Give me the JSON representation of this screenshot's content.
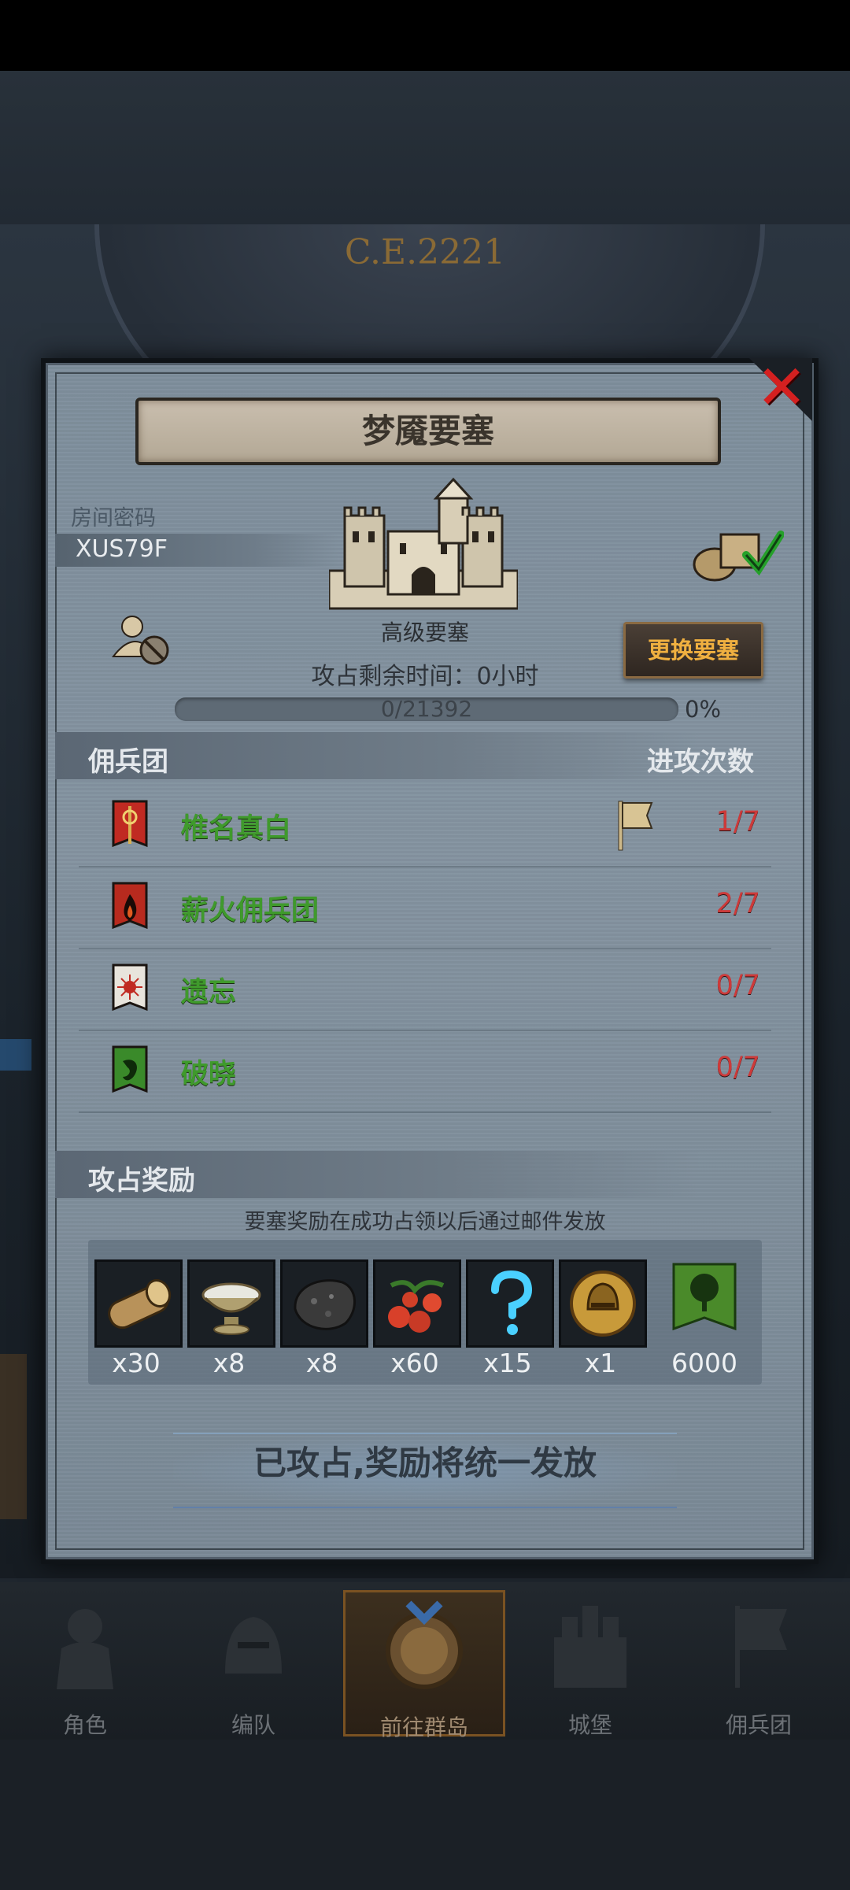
{
  "background": {
    "era_text": "C.E.2221"
  },
  "modal": {
    "title": "梦魇要塞",
    "room_label": "房间密码",
    "room_code": "XUS79F",
    "fortress_level": "高级要塞",
    "change_button": "更换要塞",
    "time_left": "攻占剩余时间：0小时",
    "progress": {
      "text": "0/21392",
      "current": 0,
      "total": 21392,
      "percent_label": "0%"
    }
  },
  "mercenaries": {
    "section_title": "佣兵团",
    "attack_count_label": "进攻次数",
    "rows": [
      {
        "name": "椎名真白",
        "count": "1/7",
        "banner_color": "#c02a22",
        "banner_icon": "staff-icon",
        "flag": true
      },
      {
        "name": "薪火佣兵团",
        "count": "2/7",
        "banner_color": "#b82a1e",
        "banner_icon": "flame-icon",
        "flag": false
      },
      {
        "name": "遗忘",
        "count": "0/7",
        "banner_color": "#e8e4dc",
        "banner_icon": "sun-icon",
        "flag": false
      },
      {
        "name": "破晓",
        "count": "0/7",
        "banner_color": "#3a8a2a",
        "banner_icon": "dragon-icon",
        "flag": false
      }
    ]
  },
  "rewards": {
    "section_title": "攻占奖励",
    "note": "要塞奖励在成功占领以后通过邮件发放",
    "items": [
      {
        "icon": "wood-log-icon",
        "qty": "x30"
      },
      {
        "icon": "bowl-icon",
        "qty": "x8"
      },
      {
        "icon": "ore-icon",
        "qty": "x8"
      },
      {
        "icon": "berries-icon",
        "qty": "x60"
      },
      {
        "icon": "mystery-icon",
        "qty": "x15"
      },
      {
        "icon": "helmet-medal-icon",
        "qty": "x1"
      },
      {
        "icon": "tree-banner-icon",
        "qty": "6000"
      }
    ],
    "claim_text": "已攻占,奖励将统一发放"
  },
  "nav": {
    "items": [
      {
        "label": "角色",
        "icon": "knight-icon",
        "active": false
      },
      {
        "label": "编队",
        "icon": "helmet-icon",
        "active": false
      },
      {
        "label": "前往群岛",
        "icon": "globe-icon",
        "active": true
      },
      {
        "label": "城堡",
        "icon": "castle-icon",
        "active": false
      },
      {
        "label": "佣兵团",
        "icon": "banner-icon",
        "active": false
      }
    ]
  },
  "colors": {
    "accent_gold": "#f0b040",
    "merc_name_green": "#3f9a2c",
    "count_red": "#cc3a3a",
    "close_red": "#d42020"
  }
}
